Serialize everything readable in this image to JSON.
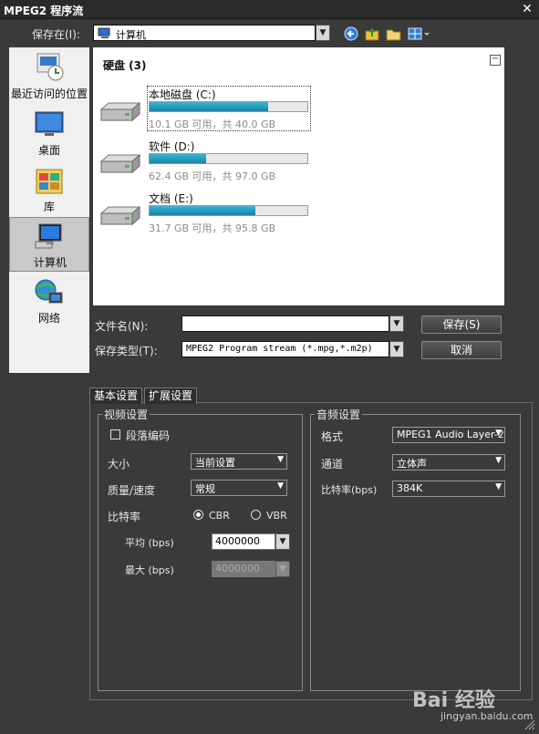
{
  "window": {
    "title": "MPEG2 程序流",
    "close": "✕"
  },
  "savein": {
    "label": "保存在(I):",
    "value": "计算机"
  },
  "places": [
    {
      "label": "最近访问的位置",
      "icon": "recent-places-icon"
    },
    {
      "label": "桌面",
      "icon": "desktop-icon"
    },
    {
      "label": "库",
      "icon": "library-icon"
    },
    {
      "label": "计算机",
      "icon": "computer-icon"
    },
    {
      "label": "网络",
      "icon": "network-icon"
    }
  ],
  "filelist": {
    "group_header": "硬盘 (3)",
    "collapse": "−",
    "drives": [
      {
        "name": "本地磁盘 (C:)",
        "info": "10.1 GB 可用，共 40.0 GB",
        "used_fraction": 0.75
      },
      {
        "name": "软件 (D:)",
        "info": "62.4 GB 可用，共 97.0 GB",
        "used_fraction": 0.36
      },
      {
        "name": "文档 (E:)",
        "info": "31.7 GB 可用，共 95.8 GB",
        "used_fraction": 0.67
      }
    ]
  },
  "filename": {
    "label": "文件名(N):",
    "value": ""
  },
  "filetype": {
    "label": "保存类型(T):",
    "value": "MPEG2 Program stream (*.mpg,*.m2p)"
  },
  "buttons": {
    "save": "保存(S)",
    "cancel": "取消"
  },
  "tabs": [
    "基本设置",
    "扩展设置"
  ],
  "video": {
    "title": "视频设置",
    "segment_label": "段落编码",
    "size_label": "大小",
    "size_value": "当前设置",
    "quality_label": "质量/速度",
    "quality_value": "常规",
    "bitrate_label": "比特率",
    "cbr": "CBR",
    "vbr": "VBR",
    "avg_label": "平均 (bps)",
    "avg_value": "4000000",
    "max_label": "最大 (bps)",
    "max_value": "4000000"
  },
  "audio": {
    "title": "音频设置",
    "format_label": "格式",
    "format_value": "MPEG1 Audio Layer-2",
    "channel_label": "通道",
    "channel_value": "立体声",
    "bitrate_label": "比特率(bps)",
    "bitrate_value": "384K"
  },
  "watermark": {
    "brand": "Bai 经验",
    "url": "jingyan.baidu.com"
  },
  "colors": {
    "accent_bar": "#1a9cc4",
    "dark_bg": "#3a3a3a"
  }
}
